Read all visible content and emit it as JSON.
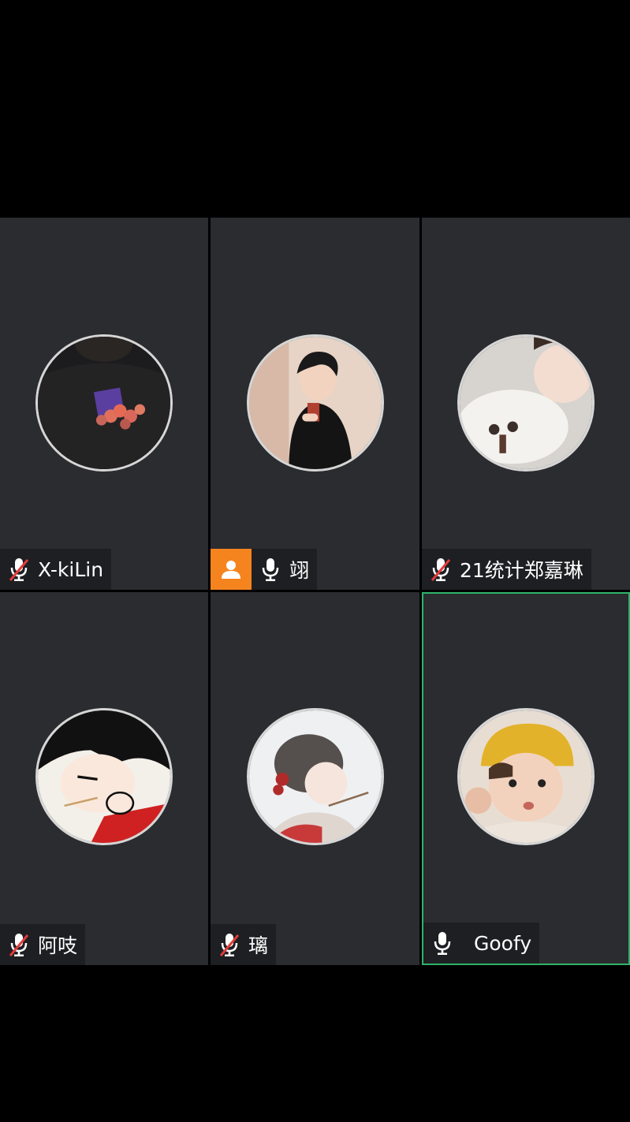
{
  "theme": {
    "background": "#000000",
    "tile_background": "#2b2c30",
    "namebar_background": "#1e1f22",
    "host_badge_color": "#f5841f",
    "active_speaker_border": "#2fb36a",
    "muted_slash_color": "#e23b3b"
  },
  "participants": [
    {
      "name": "X-kiLin",
      "mic": "muted",
      "host": false,
      "active": false,
      "avatar": "photo-dark-flowers"
    },
    {
      "name": "翊",
      "mic": "on",
      "host": true,
      "active": false,
      "avatar": "illustration-man-drink"
    },
    {
      "name": "21统计郑嘉琳",
      "mic": "muted",
      "host": false,
      "active": false,
      "avatar": "photo-girl-white-dog"
    },
    {
      "name": "阿吱",
      "mic": "muted",
      "host": false,
      "active": false,
      "avatar": "cartoon-girl-red"
    },
    {
      "name": "璃",
      "mic": "muted",
      "host": false,
      "active": false,
      "avatar": "illustration-girl-red-bow"
    },
    {
      "name": "Goofy",
      "mic": "on",
      "host": false,
      "active": true,
      "avatar": "photo-child-yellow-hat"
    }
  ]
}
